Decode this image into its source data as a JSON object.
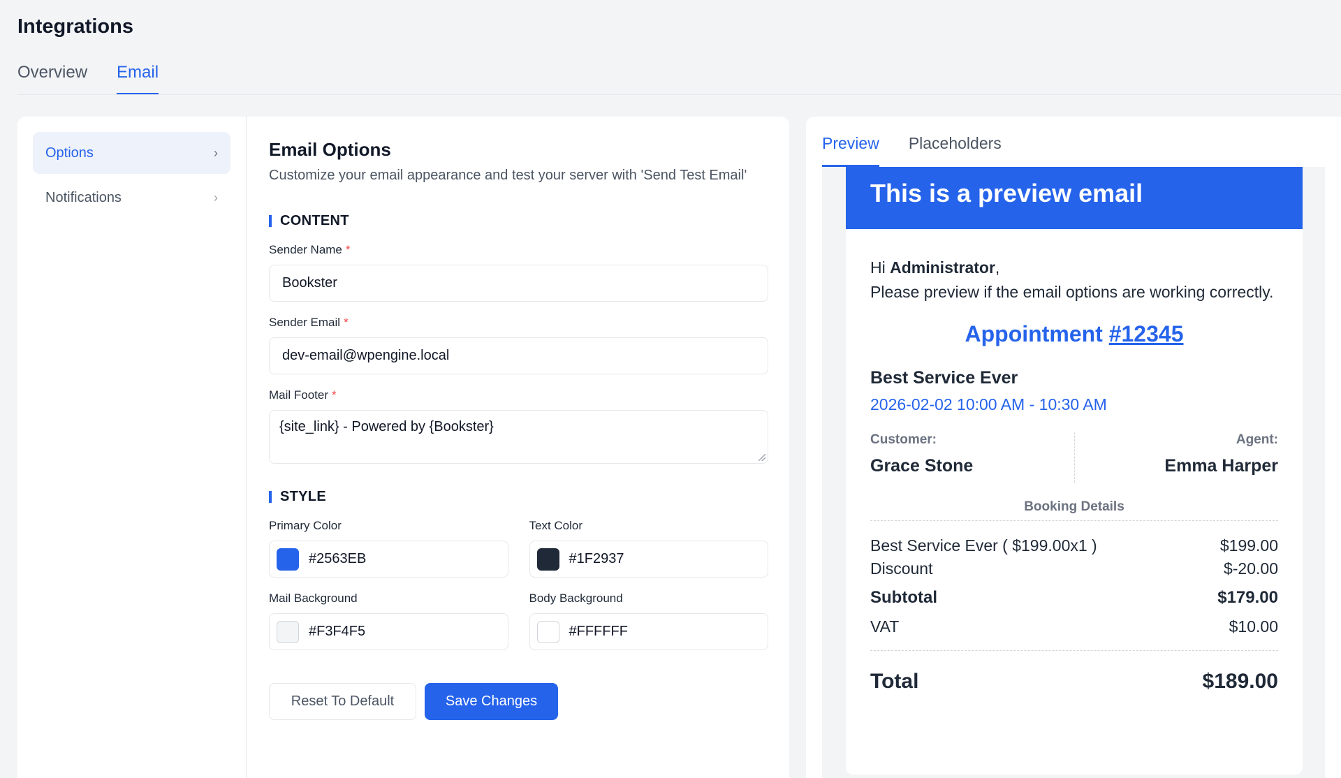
{
  "page": {
    "title": "Integrations",
    "tabs": [
      {
        "label": "Overview"
      },
      {
        "label": "Email"
      }
    ]
  },
  "sidebar": {
    "items": [
      {
        "label": "Options"
      },
      {
        "label": "Notifications"
      }
    ]
  },
  "form": {
    "title": "Email Options",
    "subtitle": "Customize your email appearance and test your server with 'Send Test Email'",
    "content_section": "CONTENT",
    "sender_name_label": "Sender Name",
    "sender_name_value": "Bookster",
    "sender_email_label": "Sender Email",
    "sender_email_value": "dev-email@wpengine.local",
    "mail_footer_label": "Mail Footer",
    "mail_footer_value": "{site_link} - Powered by {Bookster}",
    "required_mark": "*",
    "style_section": "STYLE",
    "primary_color_label": "Primary Color",
    "primary_color_value": "#2563EB",
    "text_color_label": "Text Color",
    "text_color_value": "#1F2937",
    "mail_background_label": "Mail Background",
    "mail_background_value": "#F3F4F5",
    "body_background_label": "Body Background",
    "body_background_value": "#FFFFFF",
    "reset_label": "Reset To Default",
    "save_label": "Save Changes"
  },
  "preview": {
    "tabs": [
      {
        "label": "Preview"
      },
      {
        "label": "Placeholders"
      }
    ],
    "header": "This is a preview email",
    "greeting_prefix": "Hi",
    "greeting_name": "Administrator",
    "greeting_suffix": ",",
    "message": "Please preview if the email options are working correctly.",
    "appointment_label": "Appointment",
    "appointment_number": "#12345",
    "service_name": "Best Service Ever",
    "service_time": "2026-02-02 10:00 AM - 10:30 AM",
    "customer_label": "Customer:",
    "customer_name": "Grace Stone",
    "agent_label": "Agent:",
    "agent_name": "Emma Harper",
    "booking_details": "Booking Details",
    "line_items": [
      {
        "label": "Best Service Ever ( $199.00x1 )",
        "value": "$199.00"
      },
      {
        "label": "Discount",
        "value": "$-20.00"
      },
      {
        "label": "Subtotal",
        "value": "$179.00"
      },
      {
        "label": "VAT",
        "value": "$10.00"
      }
    ],
    "total_label": "Total",
    "total_value": "$189.00"
  },
  "colors": {
    "accent": "#2563eb",
    "primary_swatch": "#2563EB",
    "text_swatch": "#1F2937",
    "mail_bg_swatch": "#F3F4F5",
    "body_bg_swatch": "#FFFFFF"
  }
}
